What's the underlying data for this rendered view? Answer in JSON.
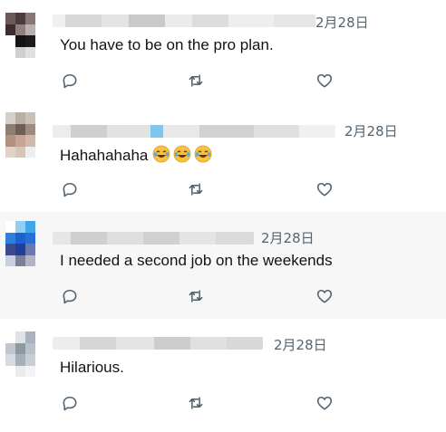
{
  "replies": [
    {
      "date": "2月28日",
      "text": "You have to be on the pro plan.",
      "emojis": ""
    },
    {
      "date": "2月28日",
      "text": "Hahahahaha ",
      "emojis": "😂😂😂"
    },
    {
      "date": "2月28日",
      "text": "I needed a second job on the weekends",
      "emojis": ""
    },
    {
      "date": "2月28日",
      "text": "Hilarious.",
      "emojis": ""
    }
  ],
  "icons": {
    "reply": "reply-icon",
    "retweet": "retweet-icon",
    "like": "heart-icon"
  },
  "colors": {
    "text": "#0f1419",
    "meta": "#536471",
    "icon": "#536471",
    "hover_bg": "#f7f7f7",
    "divider": "#eff3f4"
  }
}
